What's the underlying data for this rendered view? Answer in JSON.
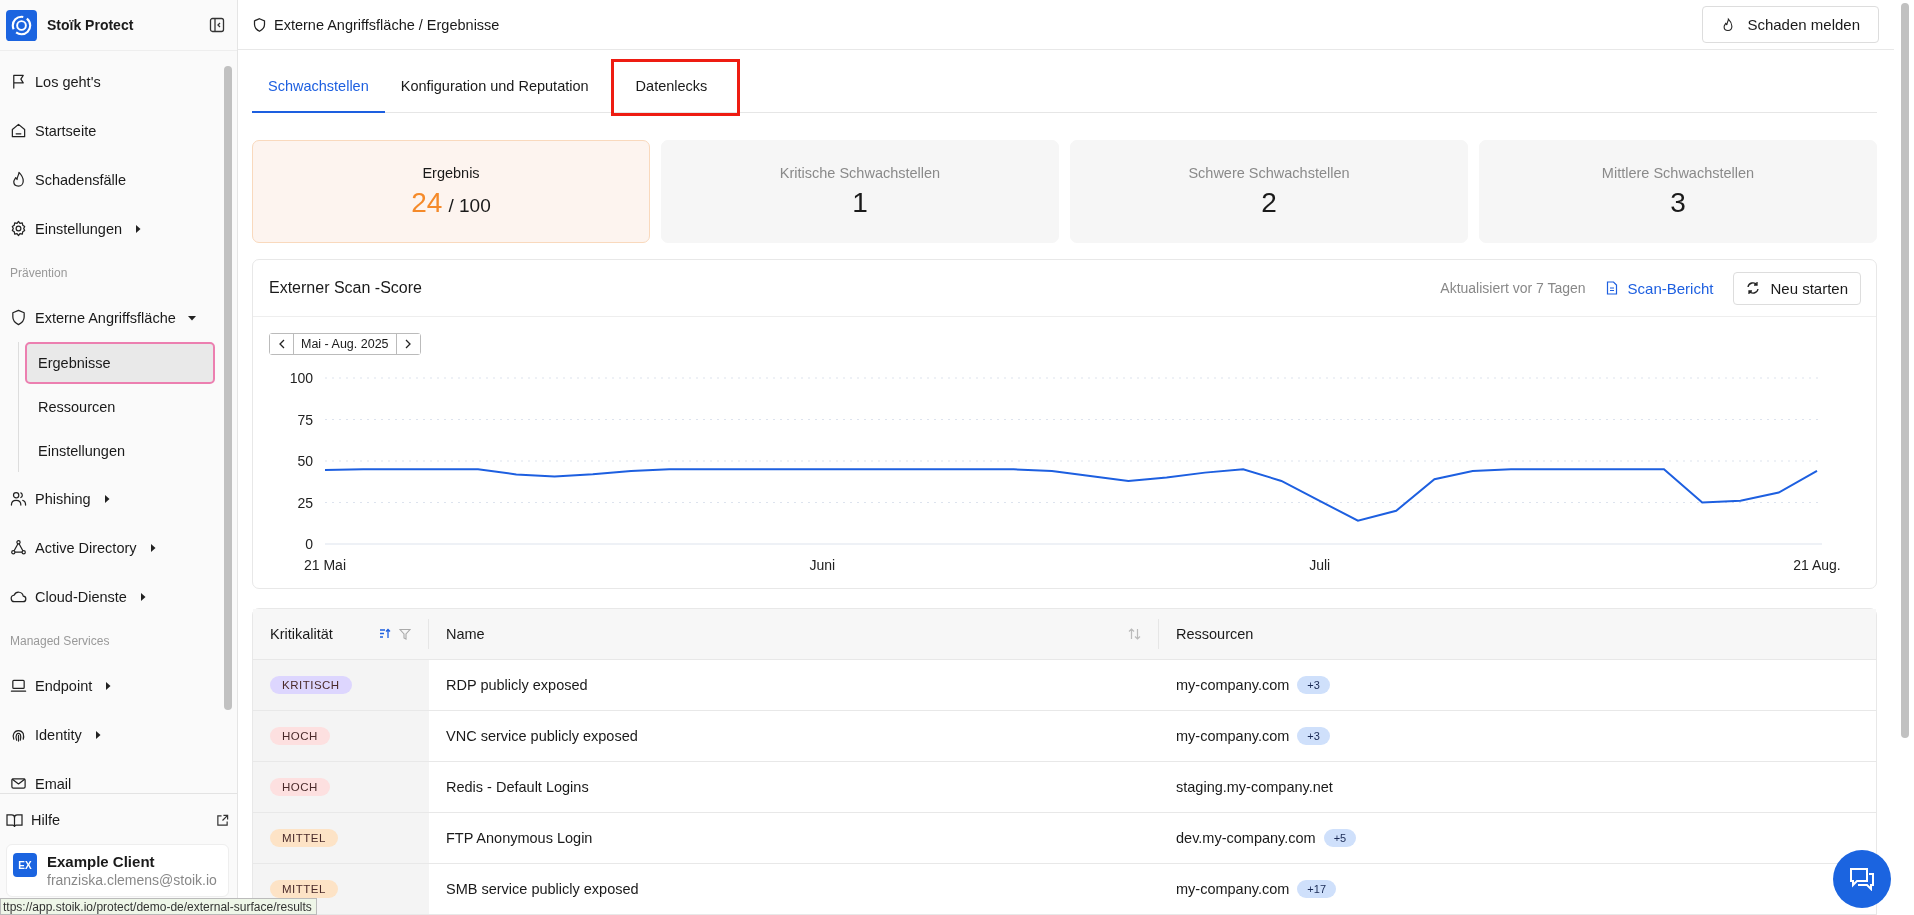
{
  "sidebar": {
    "brand": "Stoïk Protect",
    "nav": [
      {
        "kind": "item",
        "label": "Los geht's"
      },
      {
        "kind": "item",
        "label": "Startseite"
      },
      {
        "kind": "item",
        "label": "Schadensfälle"
      },
      {
        "kind": "item",
        "label": "Einstellungen",
        "expanded": false
      },
      {
        "kind": "section",
        "label": "Prävention"
      },
      {
        "kind": "item",
        "label": "Externe Angriffsfläche",
        "expanded": true,
        "children": [
          {
            "label": "Ergebnisse",
            "selected": true
          },
          {
            "label": "Ressourcen",
            "selected": false
          },
          {
            "label": "Einstellungen",
            "selected": false
          }
        ]
      },
      {
        "kind": "item",
        "label": "Phishing",
        "expanded": false
      },
      {
        "kind": "item",
        "label": "Active Directory",
        "expanded": false
      },
      {
        "kind": "item",
        "label": "Cloud-Dienste",
        "expanded": false
      },
      {
        "kind": "section",
        "label": "Managed Services"
      },
      {
        "kind": "item",
        "label": "Endpoint",
        "expanded": false
      },
      {
        "kind": "item",
        "label": "Identity",
        "expanded": false
      },
      {
        "kind": "item",
        "label": "Email"
      }
    ],
    "help": "Hilfe",
    "account": {
      "initials": "EX",
      "name": "Example Client",
      "email": "franziska.clemens@stoik.io"
    }
  },
  "header": {
    "breadcrumb": "Externe Angriffsfläche / Ergebnisse",
    "report_button": "Schaden melden"
  },
  "tabs": [
    {
      "label": "Schwachstellen",
      "selected": true,
      "highlighted": false
    },
    {
      "label": "Konfiguration und Reputation",
      "selected": false,
      "highlighted": false
    },
    {
      "label": "Datenlecks",
      "selected": false,
      "highlighted": true
    }
  ],
  "summary_cards": [
    {
      "kind": "score",
      "label": "Ergebnis",
      "value": "24",
      "total": "/ 100"
    },
    {
      "kind": "count",
      "label": "Kritische Schwachstellen",
      "value": "1"
    },
    {
      "kind": "count",
      "label": "Schwere Schwachstellen",
      "value": "2"
    },
    {
      "kind": "count",
      "label": "Mittlere Schwachstellen",
      "value": "3"
    }
  ],
  "scan_chart": {
    "title": "Externer Scan -Score",
    "updated": "Aktualisiert vor 7 Tagen",
    "report_link": "Scan-Bericht",
    "restart_button": "Neu starten",
    "period": "Mai - Aug. 2025",
    "chart_data": {
      "type": "line",
      "categories": [
        "21 Mai",
        null,
        null,
        null,
        null,
        null,
        null,
        null,
        null,
        null,
        null,
        null,
        null,
        "Juni",
        null,
        null,
        null,
        null,
        null,
        null,
        null,
        null,
        null,
        null,
        null,
        null,
        "Juli",
        null,
        null,
        null,
        null,
        null,
        null,
        null,
        null,
        null,
        null,
        null,
        null,
        "21 Aug."
      ],
      "series": [
        {
          "color": "#1d5fe0",
          "values": [
            44.6,
            45.1,
            45,
            45.1,
            45,
            41.9,
            40.7,
            42,
            44,
            45,
            45,
            45,
            45,
            45,
            45,
            45,
            45,
            45,
            45,
            44,
            41,
            38,
            40,
            43,
            45,
            38,
            26,
            14,
            20,
            39,
            44,
            45,
            45,
            45,
            45,
            45,
            25,
            26,
            31,
            44
          ]
        }
      ],
      "ylim": [
        0,
        100
      ],
      "yticks": [
        0,
        25,
        50,
        75,
        100
      ],
      "grid": true
    }
  },
  "table": {
    "columns": [
      {
        "label": "Kritikalität",
        "sorted": true
      },
      {
        "label": "Name",
        "sorted": false
      },
      {
        "label": "Ressourcen"
      }
    ],
    "rows": [
      {
        "severity": "KRITISCH",
        "color": "#ddd6fe",
        "name": "RDP publicly exposed",
        "resource": "my-company.com",
        "more": "+3"
      },
      {
        "severity": "HOCH",
        "color": "#fde0e0",
        "name": "VNC service publicly exposed",
        "resource": "my-company.com",
        "more": "+3"
      },
      {
        "severity": "HOCH",
        "color": "#fde0e0",
        "name": "Redis - Default Logins",
        "resource": "staging.my-company.net"
      },
      {
        "severity": "MITTEL",
        "color": "#fde3c6",
        "name": "FTP Anonymous Login",
        "resource": "dev.my-company.com",
        "more": "+5"
      },
      {
        "severity": "MITTEL",
        "color": "#fde3c6",
        "name": "SMB service publicly exposed",
        "resource": "my-company.com",
        "more": "+17"
      }
    ]
  },
  "status_url": "ttps://app.stoik.io/protect/demo-de/external-surface/results"
}
